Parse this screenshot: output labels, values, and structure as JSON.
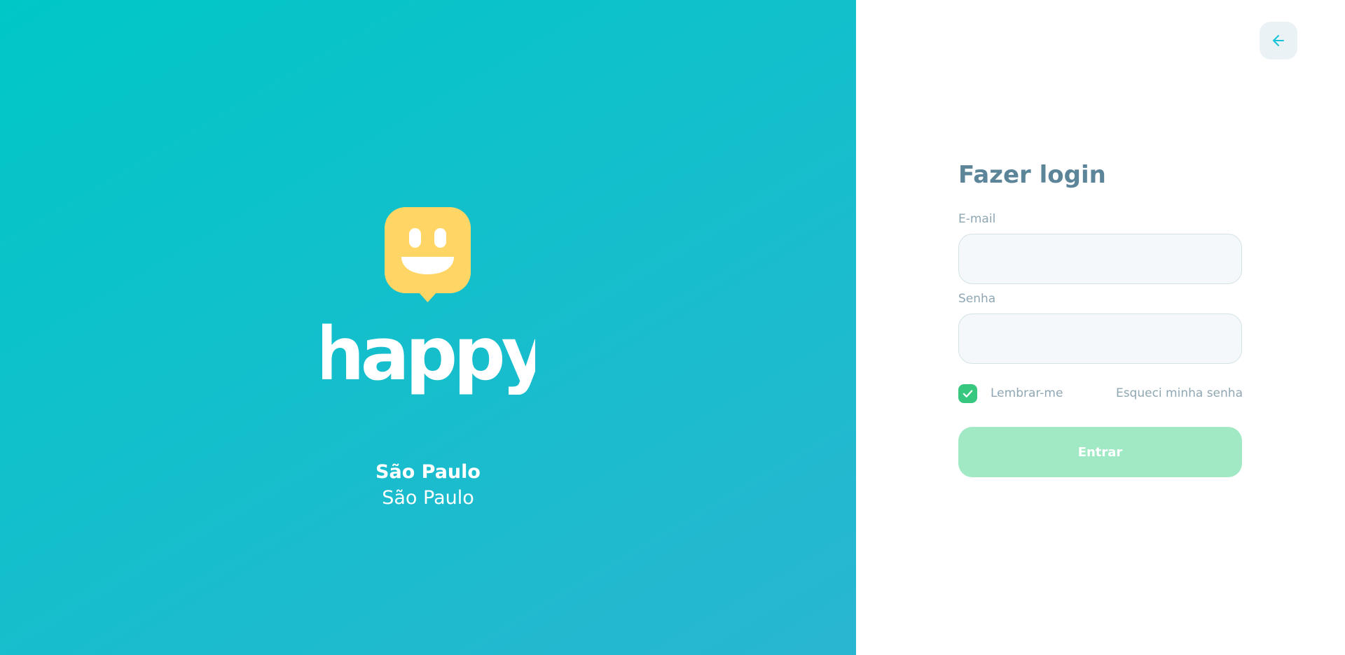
{
  "brand": {
    "logo_text": "happy",
    "logo_icon": "smiley-pin-icon",
    "location": {
      "city": "São Paulo",
      "state": "São Paulo"
    }
  },
  "back_button": {
    "icon": "arrow-left-icon"
  },
  "login_form": {
    "title": "Fazer login",
    "email": {
      "label": "E-mail",
      "value": "",
      "placeholder": ""
    },
    "password": {
      "label": "Senha",
      "value": "",
      "placeholder": ""
    },
    "remember_me": {
      "label": "Lembrar-me",
      "checked": true,
      "icon": "check-icon"
    },
    "forgot_password_label": "Esqueci minha senha",
    "submit_label": "Entrar"
  },
  "colors": {
    "gradient_start": "#00C7C7",
    "gradient_end": "#29B6D1",
    "logo_yellow": "#FFD666",
    "title_color": "#5C8599",
    "label_color": "#8FA7B3",
    "input_background": "#F5F8FA",
    "input_border": "#D3E2E5",
    "checkbox_green": "#37C77F",
    "button_disabled_green": "#A1E9C5",
    "back_button_background": "#EBF2F5",
    "back_arrow": "#15C3D6"
  }
}
